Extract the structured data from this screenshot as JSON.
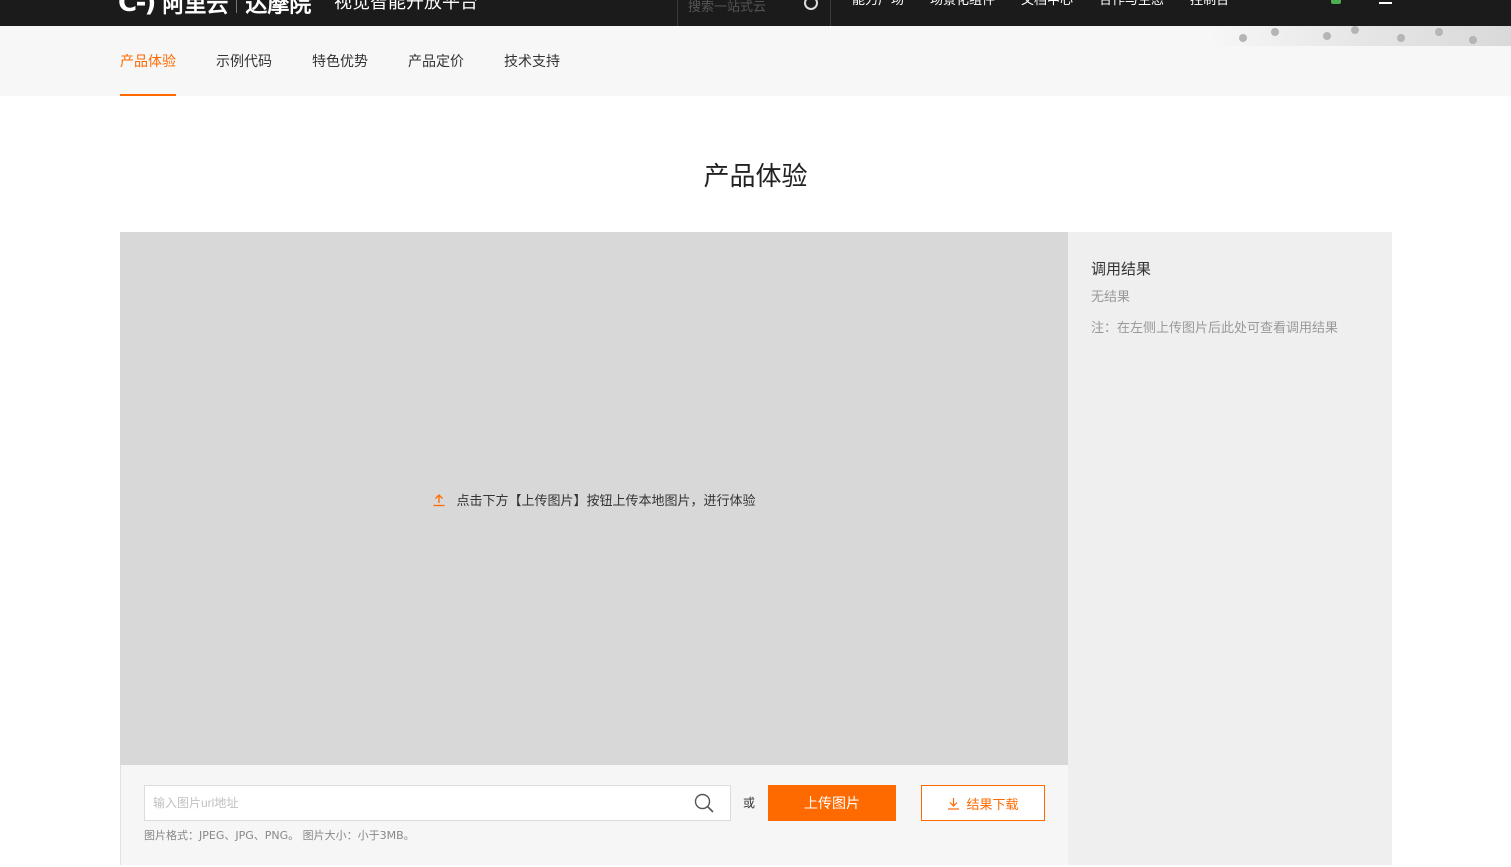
{
  "header": {
    "logo_mark": "C-)",
    "logo_text": "阿里云",
    "logo_damo": "达摩院",
    "platform_title": "视觉智能开放平台",
    "search_placeholder": "搜索一站式云",
    "nav": [
      "能力广场",
      "场景化组件",
      "文档中心",
      "合作与生态",
      "控制台"
    ]
  },
  "subnav": {
    "tabs": [
      {
        "label": "产品体验",
        "active": true
      },
      {
        "label": "示例代码",
        "active": false
      },
      {
        "label": "特色优势",
        "active": false
      },
      {
        "label": "产品定价",
        "active": false
      },
      {
        "label": "技术支持",
        "active": false
      }
    ]
  },
  "main": {
    "title": "产品体验",
    "preview_hint": "点击下方【上传图片】按钮上传本地图片，进行体验",
    "url_placeholder": "输入图片url地址",
    "or_text": "或",
    "upload_label": "上传图片",
    "download_label": "结果下载",
    "format_note": "图片格式：JPEG、JPG、PNG。 图片大小：小于3MB。"
  },
  "result": {
    "title": "调用结果",
    "empty": "无结果",
    "note": "注：在左侧上传图片后此处可查看调用结果"
  },
  "colors": {
    "accent": "#ff6a00",
    "header_bg": "#1b1b1b",
    "preview_bg": "#d8d8d8",
    "result_bg": "#efefef"
  }
}
